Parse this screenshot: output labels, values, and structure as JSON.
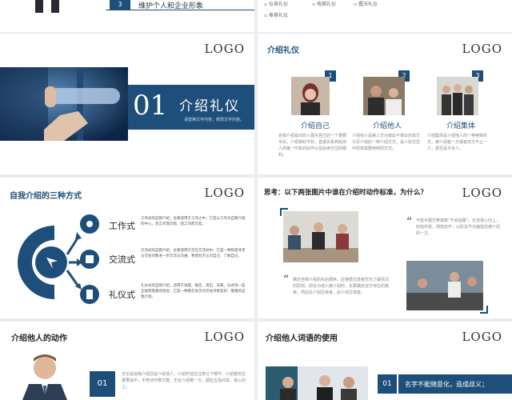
{
  "colors": {
    "primary": "#1d4f7a",
    "accent": "#2b6a9b"
  },
  "row1": {
    "left": {
      "num": "3",
      "text": "维护个人和企业形象"
    },
    "right": {
      "items": [
        "仪表礼仪",
        "电梯礼仪",
        "握沃礼仪",
        "奉茶礼仪"
      ]
    }
  },
  "slide_intro": {
    "logo": "LOGO",
    "num": "01",
    "title": "介绍礼仪",
    "subtitle": "请替换文字内容，修改文字内容。"
  },
  "slide_types": {
    "logo": "LOGO",
    "title": "介绍礼仪",
    "cards": [
      {
        "num": "1",
        "label": "介绍自己",
        "text": "自我介绍是向别人展示自己的一个重要手段，介绍得好不好，直接关系到给别人的第一印象的好坏以及后续交往的顺利。"
      },
      {
        "num": "2",
        "label": "介绍他人",
        "text": "介绍他人是第三方为彼此不相识的双方引见介绍的一种介绍方式，是人际交往中经常需要用到的方式。"
      },
      {
        "num": "3",
        "label": "介绍集体",
        "text": "介绍集体是介绍他人的一种特殊形式，被介绍者一方或者双方不止一人，甚至是许多人。"
      }
    ]
  },
  "slide_three": {
    "logo": "LOGO",
    "title": "自我介绍的三种方式",
    "items": [
      {
        "label": "工作式",
        "text": "工作式的自我介绍，主要适用于工作之中，它是以工作为自我介绍的中心，因工作而交际，因工作而交友。"
      },
      {
        "label": "交流式",
        "text": "交流式的自我介绍，主要适用于在社交活动中，它是一种刻意寻求与交往对象进一步交流与沟通，希望对方认识自己、了解自己。"
      },
      {
        "label": "礼仪式",
        "text": "礼仪式的自我介绍，适用于讲座、报告、演出、庆典、仪式等一些正规而隆重的场合，它是一种意在表示对交往对象友好、敬重的自我介绍。"
      }
    ]
  },
  "slide_think": {
    "logo": "LOGO",
    "title": "思考：以下两张图片中谁在介绍时动作标准，为什么？",
    "quote1": "不能手握空拳或者“不会指路”，应该掌心向上，四指并拢，拇指张开，以肘关节为轴指向被介绍的一方。",
    "quote2": "确定自我介绍的先后顺序，应遵循位尊者优先了解情况的原则，即在为他人做介绍时，先要确定双方地位的尊卑，然后先介绍位卑者，后介绍位尊者。"
  },
  "slide_action": {
    "logo": "LOGO",
    "title": "介绍他人的动作",
    "num": "01",
    "text": "无论是自我介绍还是介绍他人，介绍时还应注意以下细节：介绍者的位置要适中，手势动作要文雅，无论介绍哪一方，都应五指并拢，掌心向上。"
  },
  "slide_words": {
    "logo": "LOGO",
    "title": "介绍他人词语的使用",
    "num": "01",
    "text": "名字不能随意化，造成歧义；"
  }
}
